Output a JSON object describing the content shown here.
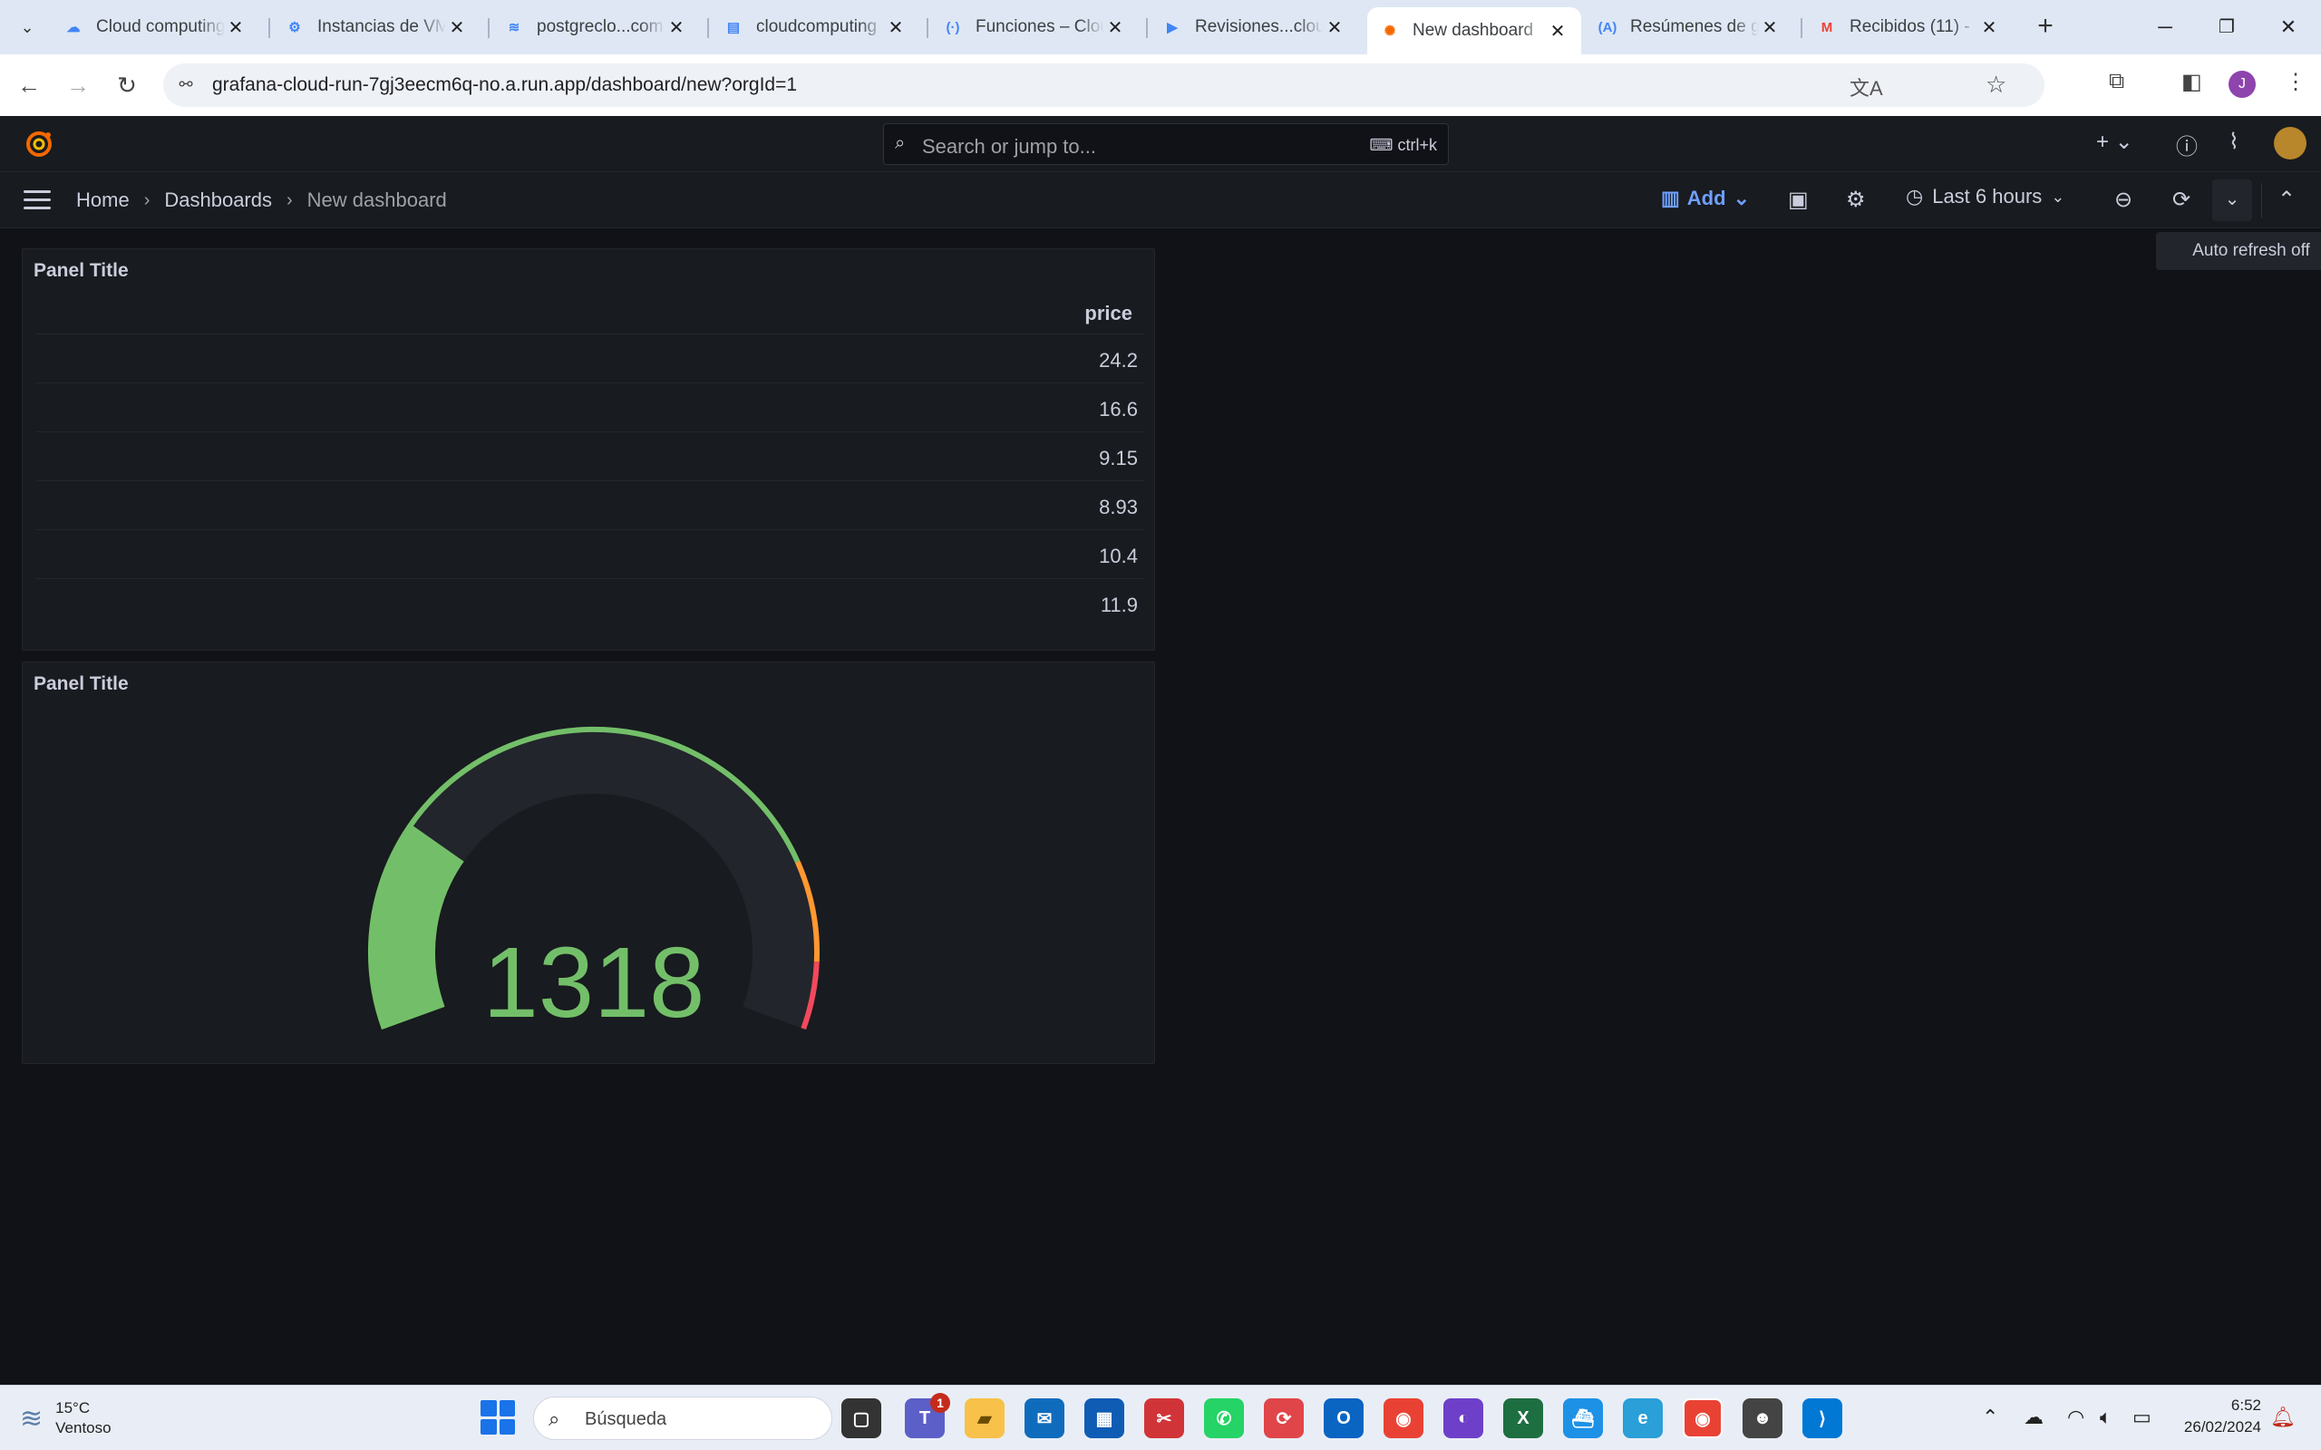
{
  "browser": {
    "tabs": [
      {
        "title": "Cloud computing",
        "icon": "google-cloud-icon"
      },
      {
        "title": "Instancias de VM",
        "icon": "compute-engine-icon"
      },
      {
        "title": "postgreclo...com",
        "icon": "cloud-sql-icon"
      },
      {
        "title": "cloudcomputing",
        "icon": "cloud-storage-icon"
      },
      {
        "title": "Funciones – Clou",
        "icon": "cloud-functions-icon"
      },
      {
        "title": "Revisiones...clou",
        "icon": "cloud-run-icon"
      },
      {
        "title": "New dashboard",
        "icon": "grafana-icon",
        "active": true
      },
      {
        "title": "Resúmenes de g",
        "icon": "ai-icon"
      },
      {
        "title": "Recibidos (11) -",
        "icon": "gmail-icon"
      }
    ],
    "url": "grafana-cloud-run-7gj3eecm6q-no.a.run.app/dashboard/new?orgId=1",
    "profile_initial": "J"
  },
  "grafana": {
    "search_placeholder": "Search or jump to...",
    "search_shortcut": "ctrl+k",
    "breadcrumbs": [
      "Home",
      "Dashboards",
      "New dashboard"
    ],
    "add_label": "Add",
    "time_range": "Last 6 hours",
    "tooltip": "Auto refresh off",
    "panels": [
      {
        "title": "Panel Title",
        "type": "table",
        "column": "price",
        "rows": [
          "24.2",
          "16.6",
          "9.15",
          "8.93",
          "10.4",
          "11.9"
        ]
      },
      {
        "title": "Panel Title",
        "type": "gauge",
        "value": "1318",
        "value_fraction": 0.25,
        "colors": {
          "green": "#73bf69",
          "orange": "#ff9830",
          "red": "#f2495c",
          "track": "#22252b"
        }
      }
    ]
  },
  "taskbar": {
    "weather_temp": "15°C",
    "weather_desc": "Ventoso",
    "search_placeholder": "Búsqueda",
    "teams_badge": "1",
    "time": "6:52",
    "date": "26/02/2024"
  }
}
